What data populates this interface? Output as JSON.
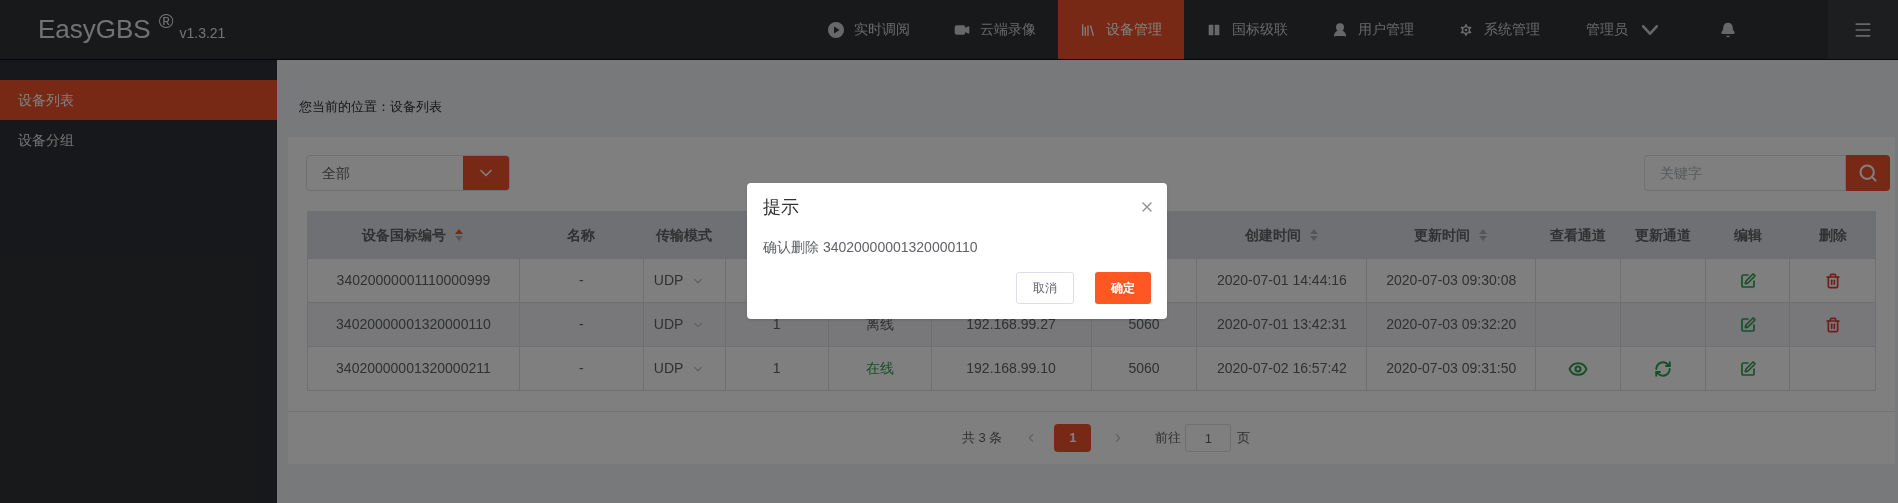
{
  "header": {
    "logo": "EasyGBS",
    "logo_mark": "®",
    "version": "v1.3.21",
    "nav": [
      {
        "kind": "play",
        "label": "实时调阅",
        "selected": false
      },
      {
        "kind": "video",
        "label": "云端录像",
        "selected": false
      },
      {
        "kind": "device",
        "label": "设备管理",
        "selected": true
      },
      {
        "kind": "cascade",
        "label": "国标级联",
        "selected": false
      },
      {
        "kind": "user",
        "label": "用户管理",
        "selected": false
      },
      {
        "kind": "settings",
        "label": "系统管理",
        "selected": false
      }
    ],
    "account": "管理员"
  },
  "sidebar": {
    "items": [
      {
        "label": "设备列表",
        "selected": true
      },
      {
        "label": "设备分组",
        "selected": false
      }
    ]
  },
  "breadcrumb": "您当前的位置：设备列表",
  "filter": {
    "value": "全部"
  },
  "search": {
    "placeholder": "关键字"
  },
  "table": {
    "columns": [
      {
        "label": "设备国标编号",
        "sorted": true
      },
      {
        "label": "名称"
      },
      {
        "label": "传输模式"
      },
      null,
      null,
      null,
      null,
      {
        "label": "创建时间",
        "sorted": false
      },
      {
        "label": "更新时间",
        "sorted": false
      },
      {
        "label": "查看通道"
      },
      {
        "label": "更新通道"
      },
      {
        "label": "编辑"
      },
      {
        "label": "删除"
      }
    ],
    "rows": [
      {
        "id": "34020000001110000999",
        "name": "-",
        "transport": "UDP",
        "channels": null,
        "status": null,
        "ip": null,
        "port": null,
        "created": "2020-07-01 14:44:16",
        "updated": "2020-07-03 09:30:08",
        "can_view": false,
        "can_refresh": false,
        "can_edit": true,
        "can_delete": true
      },
      {
        "id": "34020000001320000110",
        "name": "-",
        "transport": "UDP",
        "channels": "1",
        "status": {
          "text": "离线",
          "online": false
        },
        "ip": "192.168.99.27",
        "port": "5060",
        "created": "2020-07-01 13:42:31",
        "updated": "2020-07-03 09:32:20",
        "can_view": false,
        "can_refresh": false,
        "can_edit": true,
        "can_delete": true
      },
      {
        "id": "34020000001320000211",
        "name": "-",
        "transport": "UDP",
        "channels": "1",
        "status": {
          "text": "在线",
          "online": true
        },
        "ip": "192.168.99.10",
        "port": "5060",
        "created": "2020-07-02 16:57:42",
        "updated": "2020-07-03 09:31:50",
        "can_view": true,
        "can_refresh": true,
        "can_edit": true,
        "can_delete": false
      }
    ]
  },
  "pagination": {
    "total": "共 3 条",
    "pages": [
      {
        "label": "1",
        "selected": true
      }
    ],
    "goto_label": "前往",
    "goto_value": "1",
    "goto_suffix": "页"
  },
  "dialog": {
    "title": "提示",
    "message": "确认删除 34020000001320000110",
    "buttons": [
      {
        "kind": "cancel",
        "label": "取消"
      },
      {
        "kind": "confirm",
        "label": "确定"
      }
    ]
  }
}
